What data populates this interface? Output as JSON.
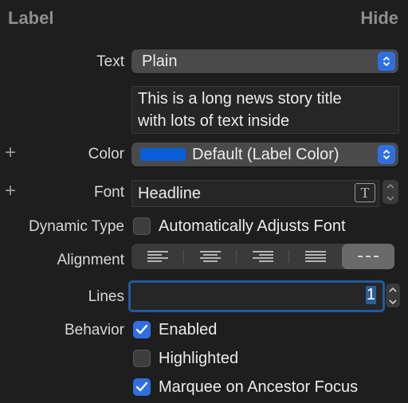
{
  "header": {
    "title": "Label",
    "hide_label": "Hide"
  },
  "text_row": {
    "label": "Text",
    "value": "Plain"
  },
  "text_content": {
    "line1": "This is a long news story title",
    "line2": "with lots of text inside"
  },
  "color_row": {
    "label": "Color",
    "value": "Default (Label Color)",
    "swatch": "#0a5fd6"
  },
  "font_row": {
    "label": "Font",
    "value": "Headline"
  },
  "dynamic_type": {
    "label": "Dynamic Type",
    "checkbox_label": "Automatically Adjusts Font",
    "checked": false
  },
  "alignment": {
    "label": "Alignment",
    "options": [
      "left-align-icon",
      "center-align-icon",
      "right-align-icon",
      "justify-align-icon",
      "natural-align-icon"
    ],
    "selected": "natural-align-icon"
  },
  "lines": {
    "label": "Lines",
    "value": "1"
  },
  "behavior": {
    "label": "Behavior",
    "items": [
      {
        "label": "Enabled",
        "checked": true
      },
      {
        "label": "Highlighted",
        "checked": false
      },
      {
        "label": "Marquee on Ancestor Focus",
        "checked": true
      }
    ]
  },
  "accent_color": "#2f6fe0"
}
